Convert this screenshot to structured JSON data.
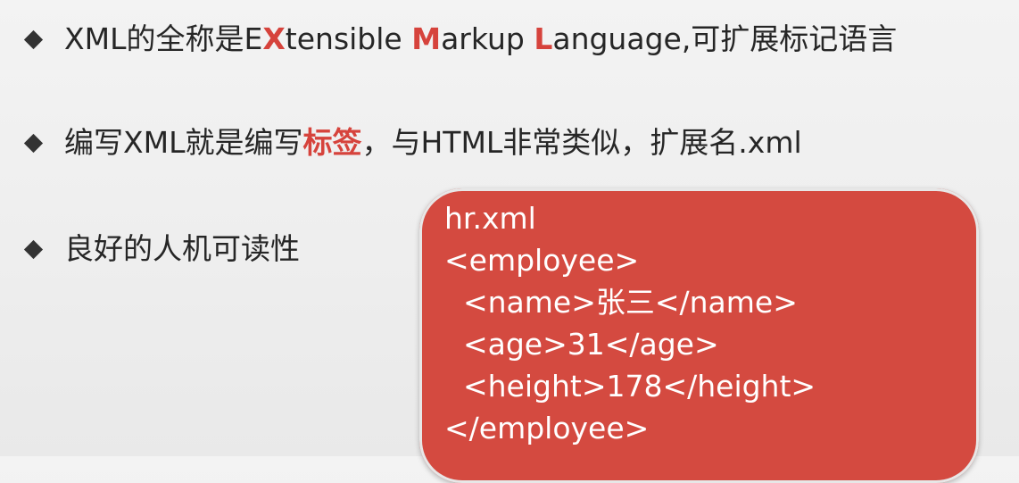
{
  "bullets": [
    {
      "parts": [
        {
          "text": "XML的全称是E",
          "accent": false
        },
        {
          "text": "X",
          "accent": true
        },
        {
          "text": "tensible ",
          "accent": false
        },
        {
          "text": "M",
          "accent": true
        },
        {
          "text": "arkup ",
          "accent": false
        },
        {
          "text": "L",
          "accent": true
        },
        {
          "text": "anguage,可扩展标记语言",
          "accent": false
        }
      ]
    },
    {
      "parts": [
        {
          "text": "编写XML就是编写",
          "accent": false
        },
        {
          "text": "标签",
          "accent": true
        },
        {
          "text": "，与HTML非常类似，扩展名.xml",
          "accent": false
        }
      ]
    },
    {
      "parts": [
        {
          "text": "良好的人机可读性",
          "accent": false
        }
      ]
    }
  ],
  "code_box": {
    "lines": [
      "hr.xml",
      "<employee>",
      "  <name>张三</name>",
      "  <age>31</age>",
      "  <height>178</height>",
      "</employee>"
    ]
  },
  "colors": {
    "accent": "#d6433c",
    "code_box_bg": "#d44a40",
    "text": "#262626"
  }
}
